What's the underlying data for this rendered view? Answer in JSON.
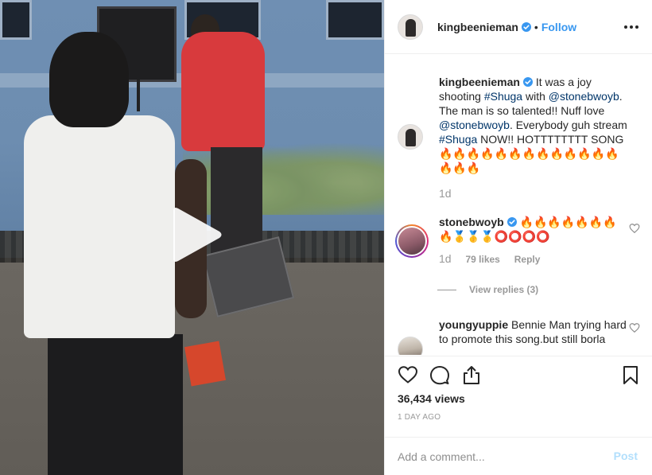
{
  "post": {
    "username": "kingbeenieman",
    "follow_label": "Follow",
    "separator": "•"
  },
  "caption": {
    "username": "kingbeenieman",
    "text_1": "It was a joy shooting ",
    "tag_1": "#Shuga",
    "text_2": " with ",
    "tag_2": "@stonebwoyb",
    "text_3": ". The man is so talented!! Nuff love ",
    "tag_3": "@stonebwoyb",
    "text_4": ". Everybody guh stream ",
    "tag_4": "#Shuga",
    "text_5": " NOW!! HOTTTTTTTT SONG",
    "emojis": "🔥🔥🔥🔥🔥🔥🔥🔥🔥🔥🔥🔥🔥🔥🔥🔥",
    "time": "1d"
  },
  "comments": [
    {
      "username": "stonebwoyb",
      "text": "🔥🔥🔥🔥🔥🔥🔥🔥🥇🥇🥇⭕⭕⭕⭕",
      "time": "1d",
      "likes": "79 likes",
      "reply_label": "Reply",
      "view_replies": "View replies (3)"
    },
    {
      "username": "youngyuppie",
      "text": "Bennie Man trying hard to promote this song.but still borla"
    }
  ],
  "stats": {
    "views": "36,434 views",
    "date": "1 DAY AGO"
  },
  "composer": {
    "placeholder": "Add a comment...",
    "post_label": "Post"
  },
  "icons": [
    "play-icon",
    "verified-badge-icon",
    "more-options-icon",
    "heart-icon",
    "comment-icon",
    "share-icon",
    "bookmark-icon"
  ],
  "colors": {
    "link": "#3897f0",
    "tag": "#003569",
    "muted": "#999999",
    "post_disabled": "#b2dffc"
  }
}
